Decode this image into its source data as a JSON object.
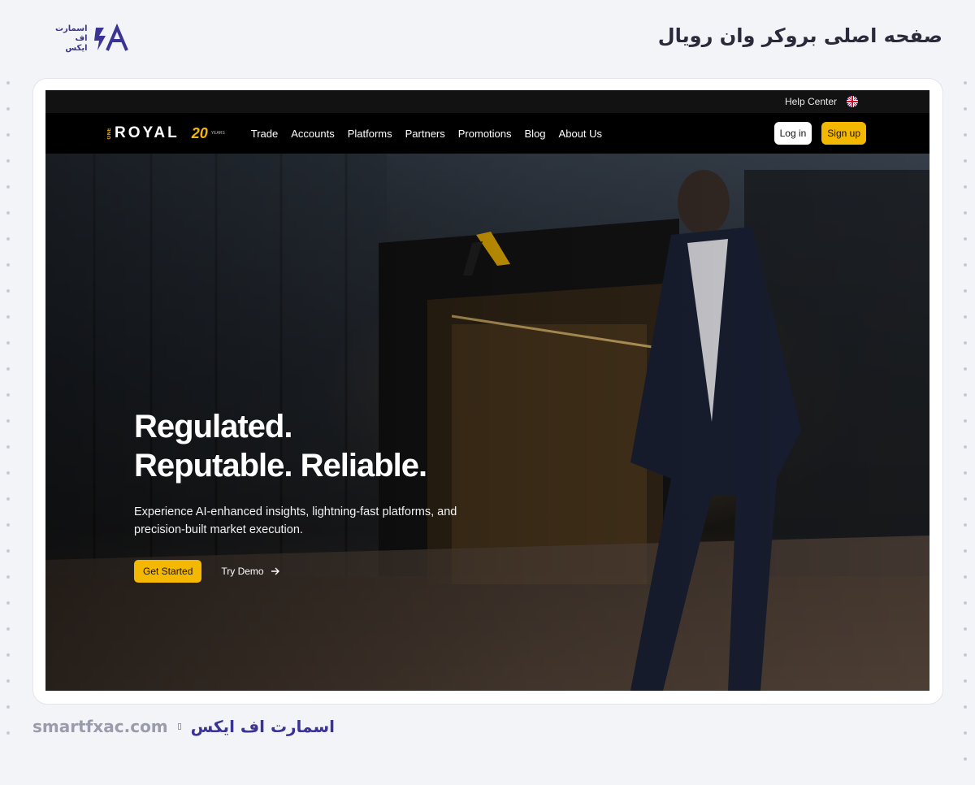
{
  "article": {
    "title": "صفحه اصلی بروکر وان رویال",
    "logo_lines": [
      "اسمارت",
      "اف",
      "ایکس"
    ]
  },
  "site": {
    "utility": {
      "help_center": "Help Center",
      "language_icon": "uk-flag-icon"
    },
    "logo": {
      "prefix": "ONE",
      "word": "ROYAL",
      "badge": "20",
      "badge_suffix": "YEARS"
    },
    "nav": {
      "items": [
        "Trade",
        "Accounts",
        "Platforms",
        "Partners",
        "Promotions",
        "Blog",
        "About Us"
      ],
      "login": "Log in",
      "signup": "Sign up"
    },
    "hero": {
      "title_line1": "Regulated.",
      "title_line2": "Reputable. Reliable.",
      "subtitle": "Experience AI-enhanced insights, lightning-fast platforms, and precision-built market execution.",
      "cta_primary": "Get Started",
      "cta_secondary": "Try Demo"
    }
  },
  "footer": {
    "domain": "smartfxac.com",
    "brand": "اسمارت اف ایکس"
  },
  "colors": {
    "accent": "#f5b800",
    "brand_purple": "#3b3494",
    "page_bg": "#f3f4f8"
  }
}
